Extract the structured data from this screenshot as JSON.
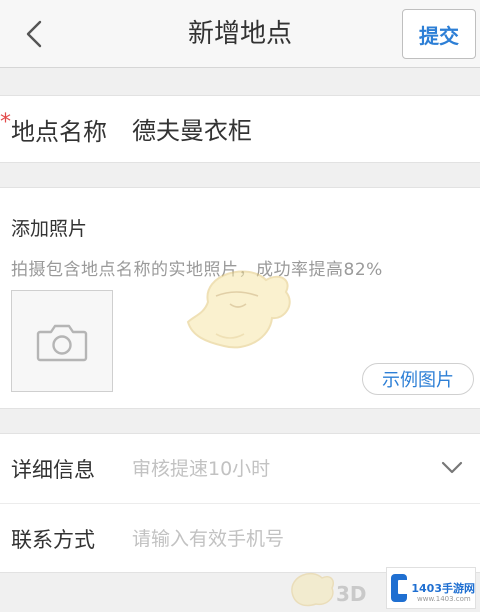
{
  "header": {
    "back_icon": "chevron-left-icon",
    "title": "新增地点",
    "submit_label": "提交"
  },
  "place_name": {
    "required_mark": "*",
    "label": "地点名称",
    "value": "德夫曼衣柜"
  },
  "photo": {
    "title": "添加照片",
    "hint": "拍摄包含地点名称的实地照片，成功率提高82%",
    "slot_icon": "camera-icon",
    "example_label": "示例图片"
  },
  "details": {
    "label": "详细信息",
    "placeholder": "审核提速10小时",
    "expand_icon": "chevron-down-icon"
  },
  "contact": {
    "label": "联系方式",
    "placeholder": "请输入有效手机号"
  },
  "watermark": {
    "text": "3D",
    "site_name": "1403手游网",
    "site_url": "www.1403.com"
  },
  "colors": {
    "accent": "#2d7fd6",
    "required": "#e24a4a",
    "background": "#f0f0f0"
  }
}
